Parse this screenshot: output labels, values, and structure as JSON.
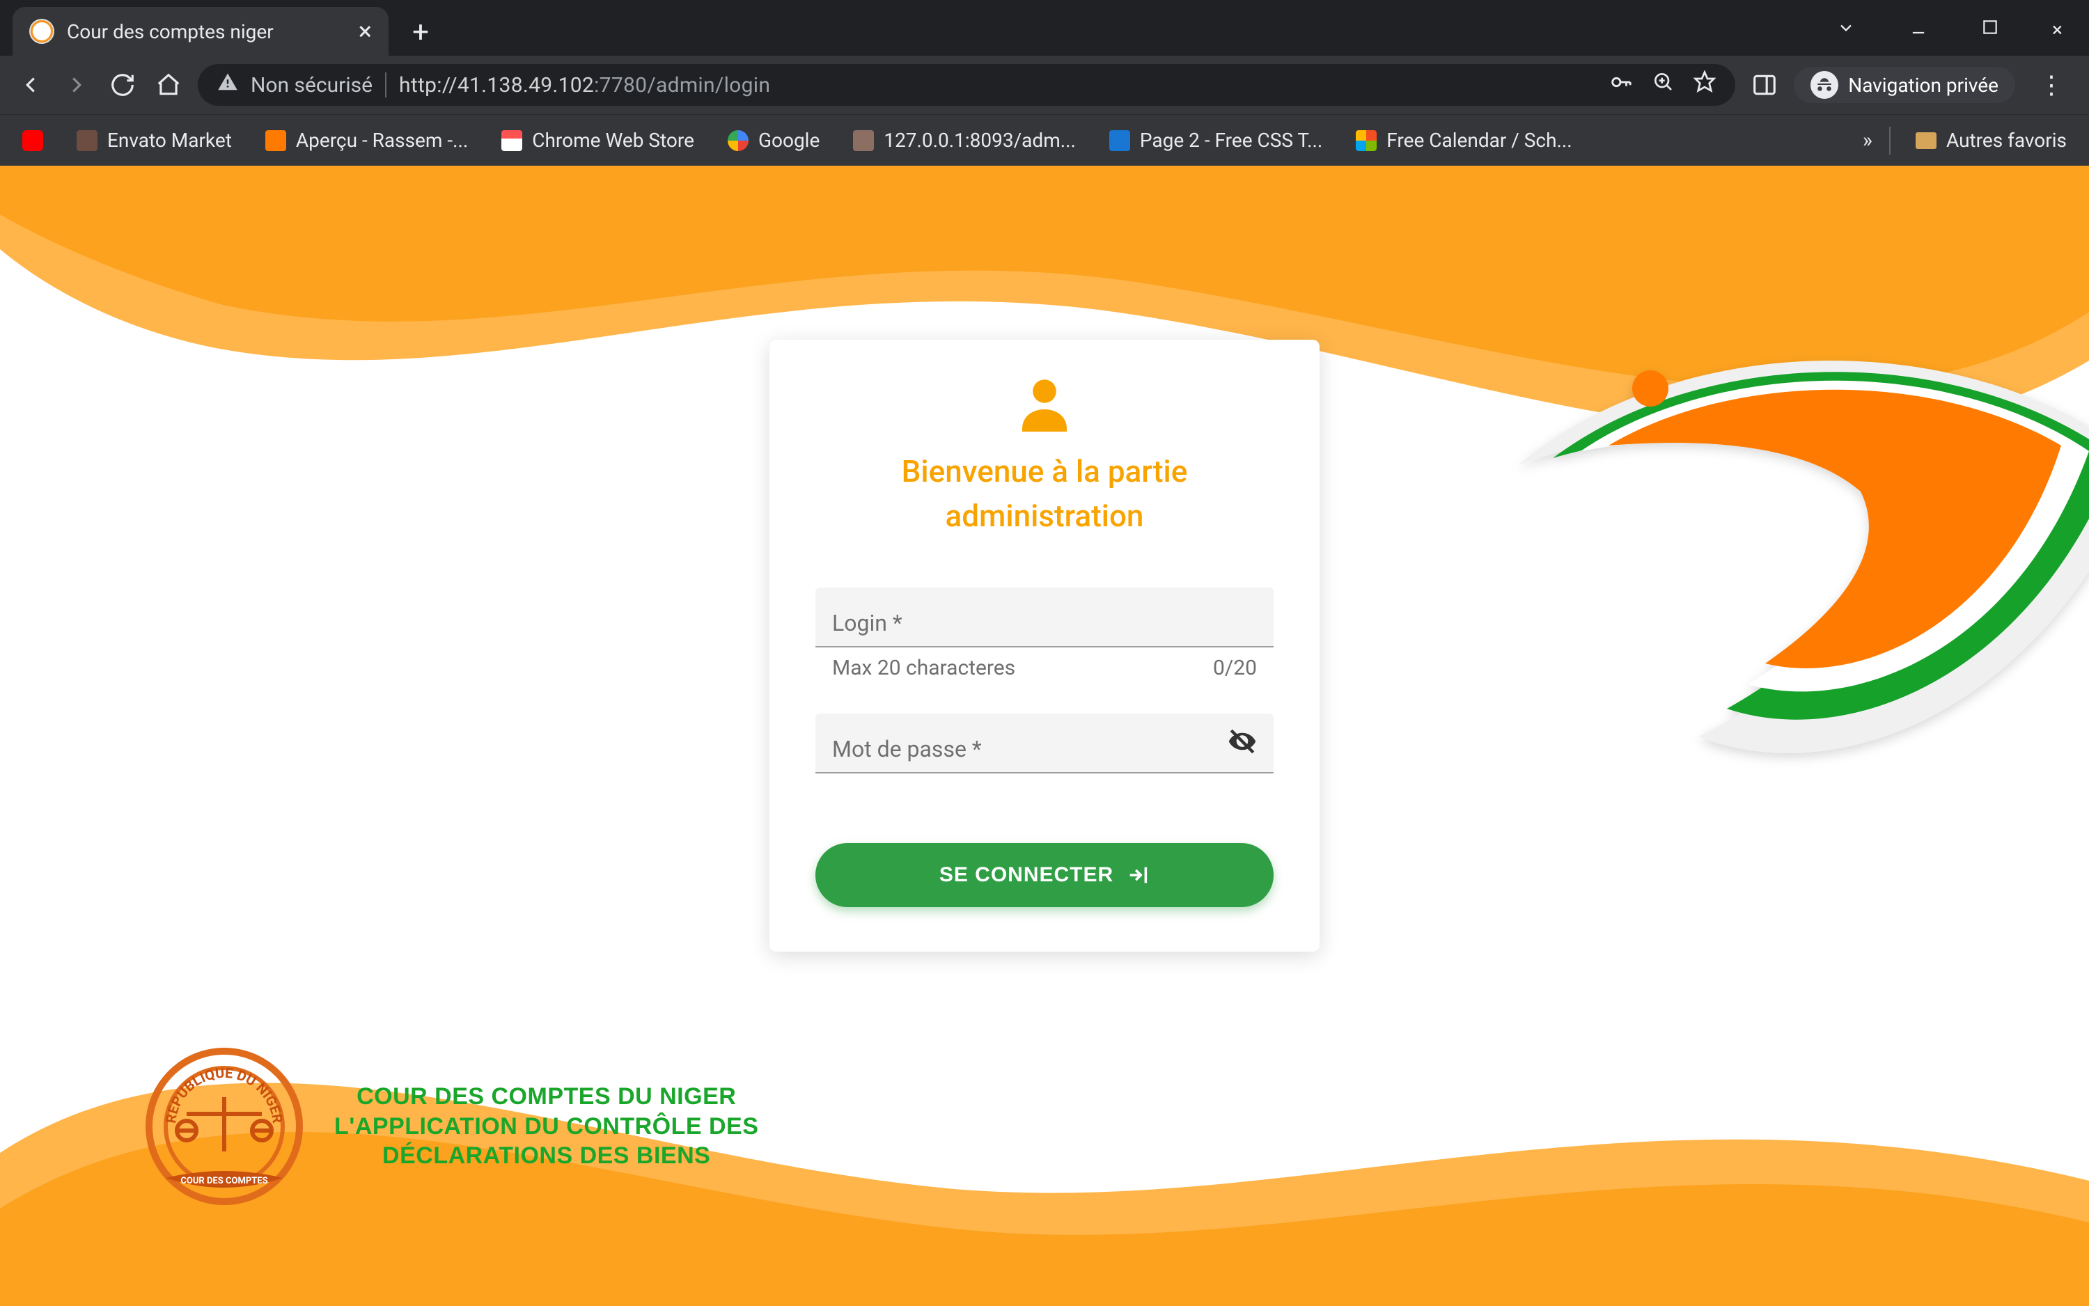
{
  "browser": {
    "tab_title": "Cour des comptes niger",
    "security_label": "Non sécurisé",
    "url_host": "http://41.138.49.102",
    "url_port": ":7780",
    "url_path": "/admin/login",
    "incognito_label": "Navigation privée",
    "bookmarks": [
      {
        "label": "",
        "icon": "red"
      },
      {
        "label": "Envato Market",
        "icon": "brown"
      },
      {
        "label": "Aperçu - Rassem -...",
        "icon": "orange"
      },
      {
        "label": "Chrome Web Store",
        "icon": "store"
      },
      {
        "label": "Google",
        "icon": "google"
      },
      {
        "label": "127.0.0.1:8093/adm...",
        "icon": "via"
      },
      {
        "label": "Page 2 - Free CSS T...",
        "icon": "tm"
      },
      {
        "label": "Free Calendar / Sch...",
        "icon": "ms"
      }
    ],
    "bookmarks_overflow_label": "»",
    "other_bookmarks_label": "Autres favoris"
  },
  "card": {
    "title_line1": "Bienvenue à la partie",
    "title_line2": "administration",
    "login_label": "Login *",
    "login_hint": "Max 20 characteres",
    "login_counter": "0/20",
    "password_label": "Mot de passe *",
    "submit_label": "SE CONNECTER"
  },
  "footer": {
    "line1": "COUR DES COMPTES DU NIGER",
    "line2": "L'APPLICATION DU CONTRÔLE DES",
    "line3": "DÉCLARATIONS DES BIENS"
  },
  "colors": {
    "orange": "#f8a300",
    "deep_orange": "#ff7a00",
    "green": "#16a22b",
    "btn_green": "#2f9e44"
  }
}
